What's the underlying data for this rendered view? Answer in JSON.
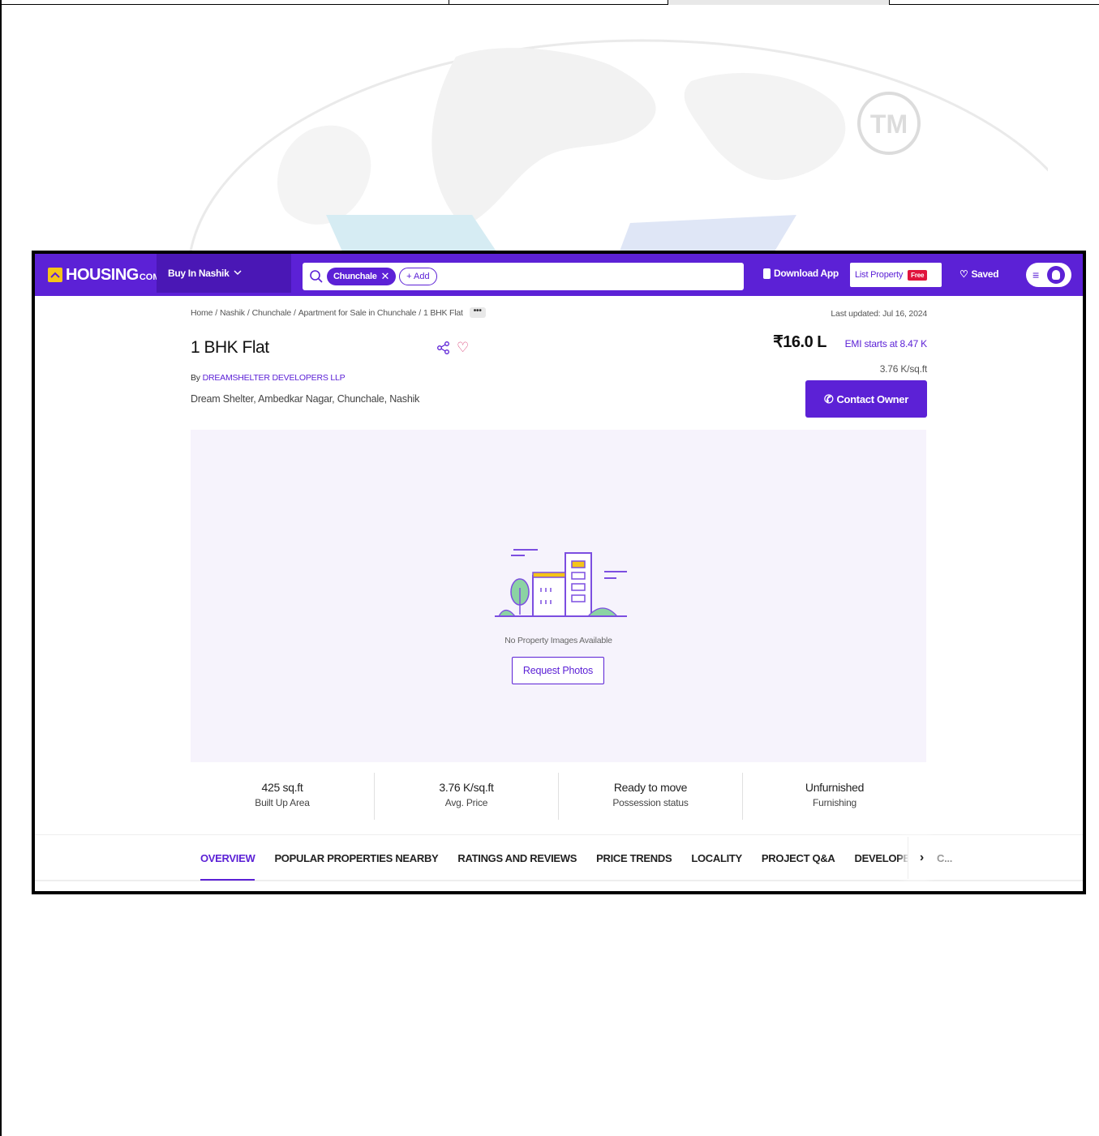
{
  "navbar": {
    "logo_text": "HOUSING",
    "logo_suffix": "COM",
    "buy_in_label": "Buy In Nashik",
    "search_chip": "Chunchale",
    "add_chip": "+ Add",
    "download_app": "Download App",
    "list_property": "List Property",
    "free_badge": "Free",
    "saved": "Saved",
    "brand_color": "#5c21d6"
  },
  "breadcrumb": {
    "items": [
      "Home",
      "Nashik",
      "Chunchale",
      "Apartment for Sale in Chunchale",
      "1 BHK Flat"
    ],
    "more": "•••"
  },
  "last_updated": "Last updated: Jul 16, 2024",
  "property": {
    "title": "1 BHK Flat",
    "by_prefix": "By",
    "developer": "DREAMSHELTER DEVELOPERS LLP",
    "address": "Dream Shelter, Ambedkar Nagar, Chunchale, Nashik",
    "price": "₹16.0 L",
    "emi": "EMI starts at 8.47 K",
    "per_sqft": "3.76 K/sq.ft",
    "contact_button": "Contact Owner"
  },
  "gallery": {
    "no_images_text": "No Property Images Available",
    "request_button": "Request Photos"
  },
  "stats": [
    {
      "value": "425 sq.ft",
      "label": "Built Up Area"
    },
    {
      "value": "3.76 K/sq.ft",
      "label": "Avg. Price"
    },
    {
      "value": "Ready to move",
      "label": "Possession status"
    },
    {
      "value": "Unfurnished",
      "label": "Furnishing"
    }
  ],
  "tabs": [
    {
      "label": "OVERVIEW",
      "active": true
    },
    {
      "label": "POPULAR PROPERTIES NEARBY",
      "active": false
    },
    {
      "label": "RATINGS AND REVIEWS",
      "active": false
    },
    {
      "label": "PRICE TRENDS",
      "active": false
    },
    {
      "label": "LOCALITY",
      "active": false
    },
    {
      "label": "PROJECT Q&A",
      "active": false
    },
    {
      "label": "DEVELOPER",
      "active": false
    },
    {
      "label": "C...",
      "active": false
    }
  ],
  "watermark_text": "TM"
}
